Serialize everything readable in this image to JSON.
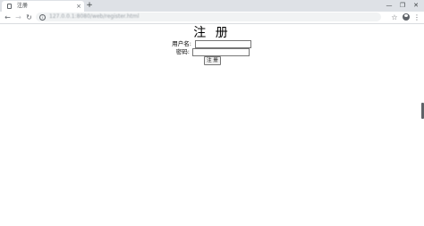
{
  "browser": {
    "tab": {
      "title": "注册",
      "close_glyph": "×"
    },
    "new_tab_glyph": "+",
    "window_controls": {
      "minimize": "—",
      "maximize": "❐",
      "close": "✕"
    },
    "nav": {
      "back": "←",
      "forward": "→",
      "reload": "↻"
    },
    "address_bar": {
      "url": "127.0.0.1:8080/web/register.html"
    },
    "star_glyph": "☆",
    "menu_glyph": "⋮"
  },
  "page": {
    "title": "注 册",
    "username_label": "用户名:",
    "password_label": "密码:",
    "username_value": "",
    "password_value": "",
    "submit_label": "注 册"
  },
  "icons": {
    "tab": "page-icon",
    "info": "info-icon",
    "star": "star-icon",
    "profile": "account-icon",
    "menu": "more-vert-icon"
  }
}
